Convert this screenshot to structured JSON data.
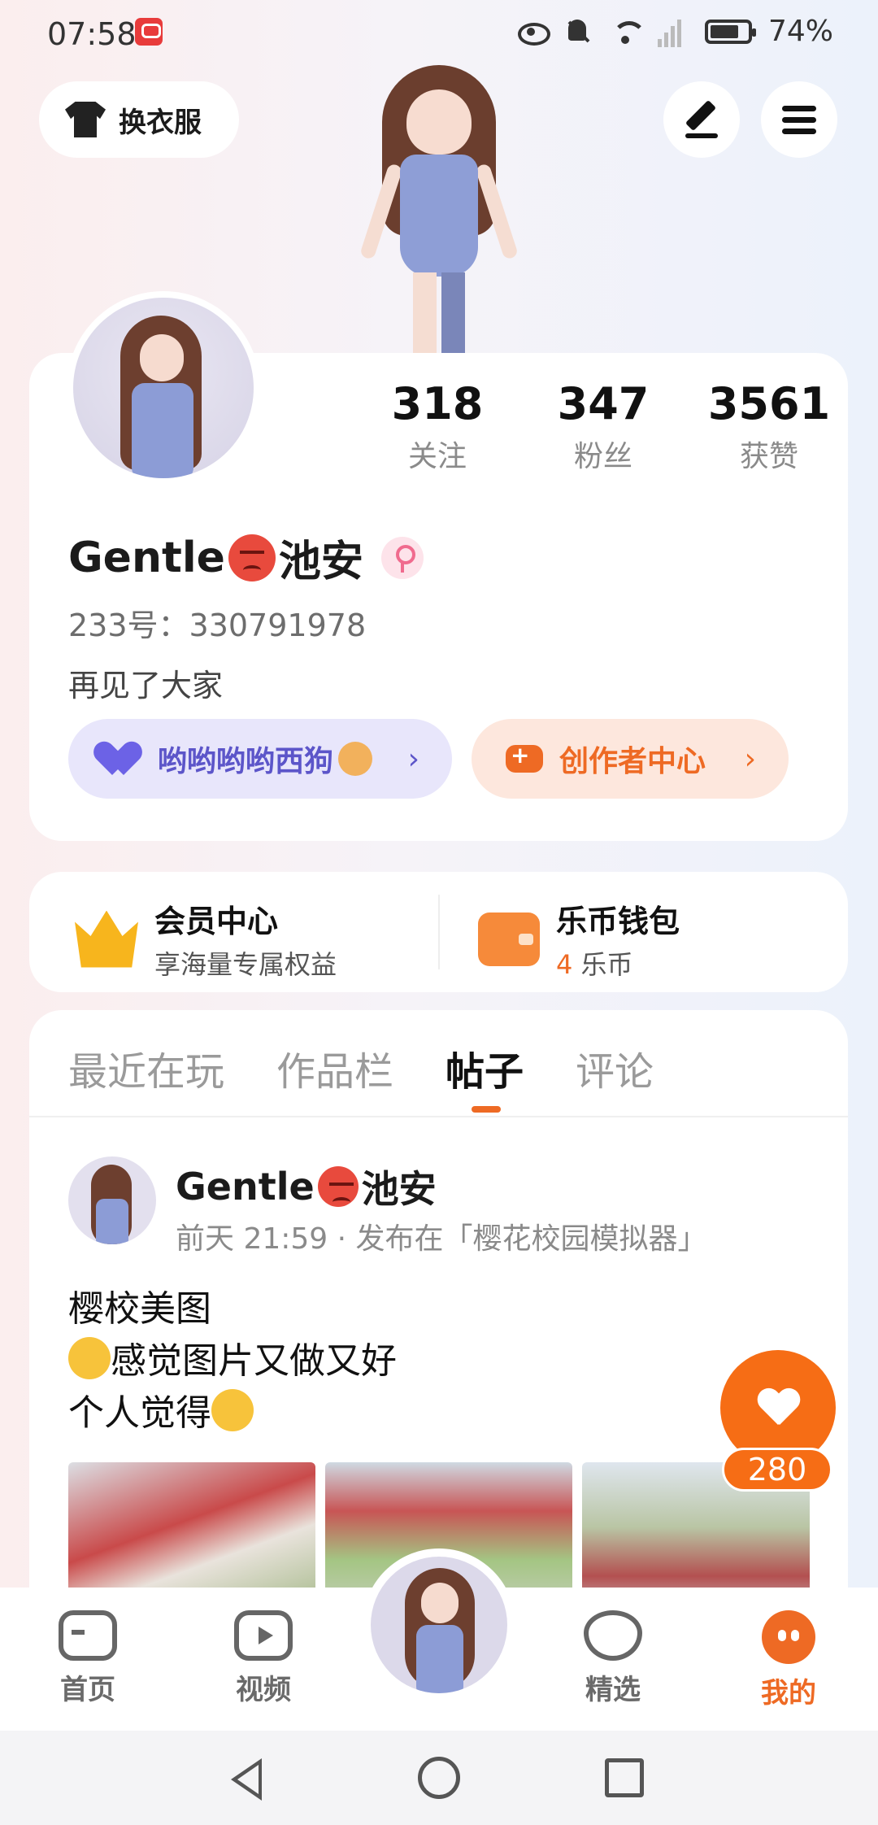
{
  "status_bar": {
    "time": "07:58",
    "battery": "74%"
  },
  "header": {
    "outfit_label": "换衣服"
  },
  "profile": {
    "stats": [
      {
        "value": "318",
        "label": "关注"
      },
      {
        "value": "347",
        "label": "粉丝"
      },
      {
        "value": "3561",
        "label": "获赞"
      }
    ],
    "name_prefix": "Gentle",
    "name_suffix": "池安",
    "id_text": "233号：330791978",
    "bio": "再见了大家",
    "group_chip_label": "哟哟哟哟西狗",
    "creator_chip_label": "创作者中心",
    "chevron": "›"
  },
  "member": {
    "vip_title": "会员中心",
    "vip_sub": "享海量专属权益",
    "wallet_title": "乐币钱包",
    "wallet_count": "4",
    "wallet_unit": " 乐币"
  },
  "tabs": [
    {
      "label": "最近在玩"
    },
    {
      "label": "作品栏"
    },
    {
      "label": "帖子"
    },
    {
      "label": "评论"
    }
  ],
  "post": {
    "author_prefix": "Gentle",
    "author_suffix": "池安",
    "meta": "前天 21:59 · 发布在「樱花校园模拟器」",
    "line1": "樱校美图",
    "line2": "感觉图片又做又好",
    "line3": "个人觉得"
  },
  "like": {
    "count": "280"
  },
  "bottom_nav": [
    {
      "label": "首页"
    },
    {
      "label": "视频"
    },
    {
      "label": "精选"
    },
    {
      "label": "我的"
    }
  ],
  "colors": {
    "accent": "#ee6a24",
    "group_chip": "#5c55c9"
  }
}
